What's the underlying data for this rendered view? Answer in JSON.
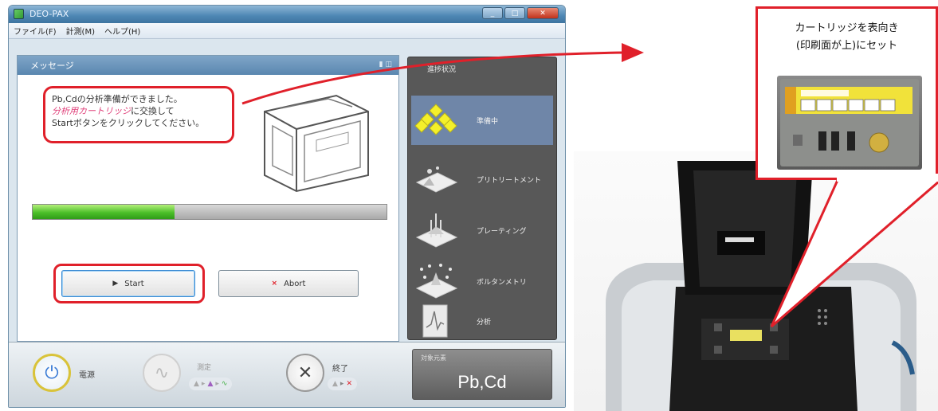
{
  "window": {
    "title": "DEO-PAX",
    "menu": [
      "ファイル(F)",
      "計測(M)",
      "ヘルプ(H)"
    ]
  },
  "message_panel": {
    "title": "メッセージ",
    "line1": "Pb,Cdの分析準備ができました。",
    "highlight": "分析用カートリッジ",
    "line2_rest": "に交換して",
    "line3": "Startボタンをクリックしてください。"
  },
  "progress": {
    "value": 0.4
  },
  "buttons": {
    "start": "Start",
    "abort": "Abort"
  },
  "steps": {
    "header": "進捗状況",
    "items": [
      {
        "label": "準備中",
        "icon": "diamond-grid-icon",
        "active": true
      },
      {
        "label": "プリトリートメント",
        "icon": "pretreatment-icon",
        "active": false
      },
      {
        "label": "プレーティング",
        "icon": "plating-icon",
        "active": false
      },
      {
        "label": "ボルタンメトリ",
        "icon": "voltammetry-icon",
        "active": false
      },
      {
        "label": "分析",
        "icon": "analysis-icon",
        "active": false
      }
    ]
  },
  "toolbar": {
    "power_label": "電源",
    "measure_label": "測定",
    "end_label": "終了",
    "element_label": "対象元素",
    "element_value": "Pb,Cd"
  },
  "callout": {
    "line1": "カートリッジを表向き",
    "line2": "(印刷面が上)にセット"
  },
  "colors": {
    "highlight_red": "#e0202a",
    "progress_green": "#4cbf2a"
  }
}
